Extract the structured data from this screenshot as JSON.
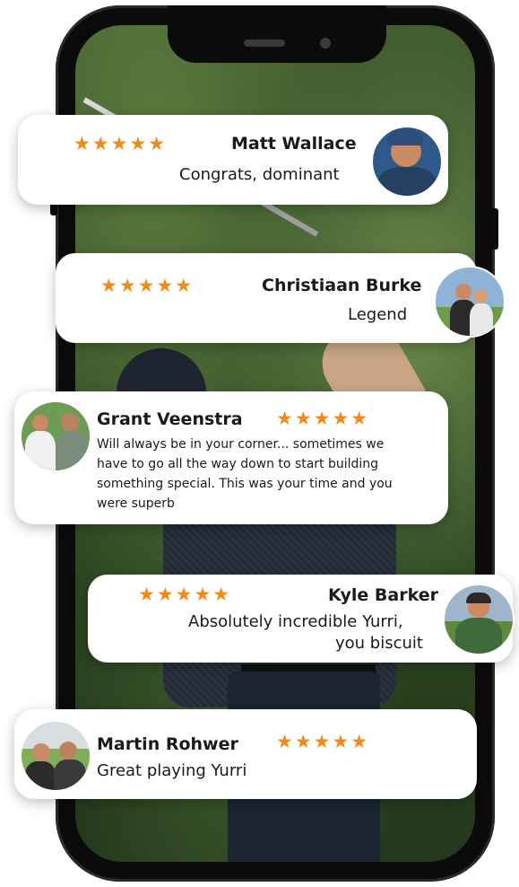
{
  "reviews": [
    {
      "name": "Matt Wallace",
      "stars": "★★★★★",
      "message": "Congrats, dominant"
    },
    {
      "name": "Christiaan Burke",
      "stars": "★★★★★",
      "message": "Legend"
    },
    {
      "name": "Grant Veenstra",
      "stars": "★★★★★",
      "message_lines": [
        "Will always be in your corner... sometimes we",
        "have to go all the way down to start building",
        "something special. This was your time and you",
        "were superb"
      ]
    },
    {
      "name": "Kyle Barker",
      "stars": "★★★★★",
      "message_lines": [
        "Absolutely incredible Yurri,",
        "you biscuit"
      ]
    },
    {
      "name": "Martin Rohwer",
      "stars": "★★★★★",
      "message": "Great playing Yurri"
    }
  ],
  "colors": {
    "star": "#f08a1c",
    "card": "#ffffff",
    "text": "#1a1a1a"
  }
}
